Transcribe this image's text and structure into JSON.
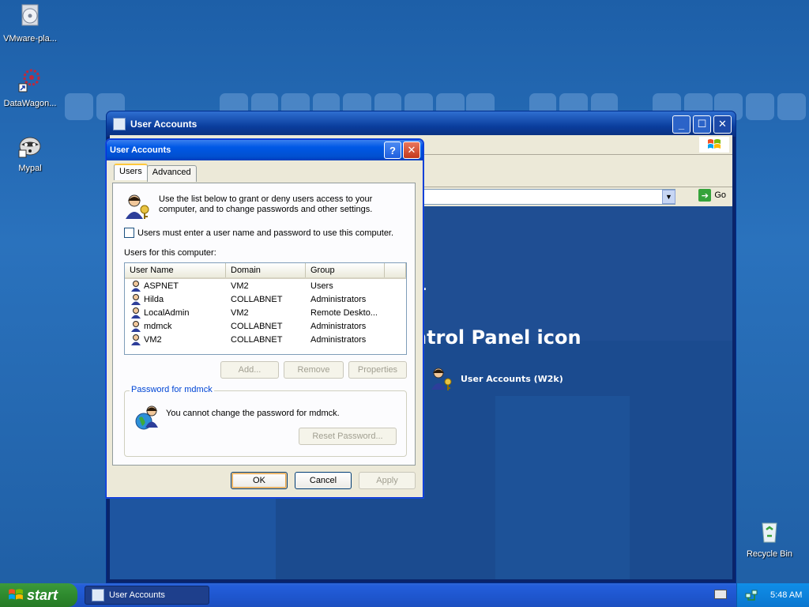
{
  "desktop": {
    "icons": [
      {
        "label": "VMware-pla...",
        "icon": "cd-installer-icon"
      },
      {
        "label": "DataWagon...",
        "icon": "datawagon-shortcut-icon"
      },
      {
        "label": "Mypal",
        "icon": "raccoon-icon"
      },
      {
        "label": "Recycle Bin",
        "icon": "recycle-bin-icon"
      }
    ]
  },
  "back_window": {
    "title": "User Accounts",
    "go_label": "Go",
    "heading": "ntrol Panel icon",
    "heading_dot": ".",
    "item_label": "User Accounts (W2k)"
  },
  "dialog": {
    "title": "User Accounts",
    "tabs": [
      {
        "label": "Users"
      },
      {
        "label": "Advanced"
      }
    ],
    "intro": "Use the list below to grant or deny users access to your computer, and to change passwords and other settings.",
    "checkbox_label": "Users must enter a user name and password to use this computer.",
    "checkbox_checked": false,
    "users_label": "Users for this computer:",
    "columns": [
      "User Name",
      "Domain",
      "Group"
    ],
    "rows": [
      {
        "name": "ASPNET",
        "domain": "VM2",
        "group": "Users"
      },
      {
        "name": "Hilda",
        "domain": "COLLABNET",
        "group": "Administrators"
      },
      {
        "name": "LocalAdmin",
        "domain": "VM2",
        "group": "Remote Deskto..."
      },
      {
        "name": "mdmck",
        "domain": "COLLABNET",
        "group": "Administrators"
      },
      {
        "name": "VM2",
        "domain": "COLLABNET",
        "group": "Administrators"
      }
    ],
    "add_label": "Add...",
    "remove_label": "Remove",
    "properties_label": "Properties",
    "password_group_label": "Password for mdmck",
    "password_text": "You cannot change the password for mdmck.",
    "reset_label": "Reset Password...",
    "ok_label": "OK",
    "cancel_label": "Cancel",
    "apply_label": "Apply"
  },
  "taskbar": {
    "start_label": "start",
    "task_label": "User Accounts",
    "clock": "5:48 AM"
  }
}
